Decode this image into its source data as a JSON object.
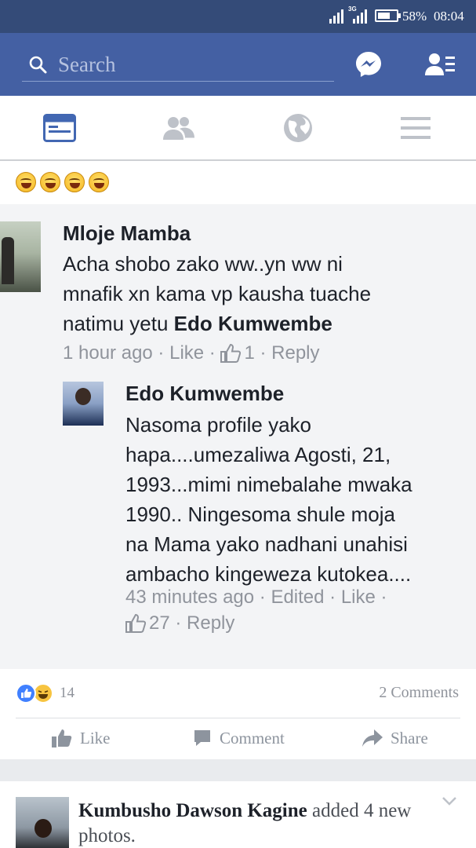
{
  "status_bar": {
    "network": "3G",
    "battery_percent": "58%",
    "battery_level": 0.58,
    "time": "08:04"
  },
  "header": {
    "search_placeholder": "Search",
    "icons": [
      "search-icon",
      "messenger-icon",
      "friend-requests-icon"
    ]
  },
  "nav_tabs": [
    {
      "name": "news-feed",
      "icon": "news-feed-icon",
      "active": true
    },
    {
      "name": "friends",
      "icon": "friends-icon",
      "active": false
    },
    {
      "name": "notifications",
      "icon": "globe-icon",
      "active": false
    },
    {
      "name": "menu",
      "icon": "hamburger-menu-icon",
      "active": false
    }
  ],
  "post": {
    "emoji_count": 4,
    "comments": [
      {
        "author": "Mloje Mamba",
        "lines": [
          "Acha shobo zako ww..yn ww ni",
          "mnafik xn kama vp kausha tuache",
          "natimu yetu "
        ],
        "mention": "Edo Kumwembe",
        "time": "1 hour ago",
        "like_label": "Like",
        "likes": "1",
        "reply_label": "Reply"
      },
      {
        "author": "Edo Kumwembe",
        "lines": [
          "Nasoma profile yako",
          "hapa....umezaliwa Agosti, 21,",
          "1993...mimi nimebalahe mwaka",
          "1990.. Ningesoma shule moja",
          "na Mama yako nadhani unahisi",
          "ambacho kingeweza kutokea...."
        ],
        "time": "43 minutes ago",
        "edited": "Edited",
        "like_label": "Like",
        "likes": "27",
        "reply_label": "Reply"
      }
    ],
    "reaction_count": "14",
    "comments_count": "2 Comments",
    "actions": {
      "like": "Like",
      "comment": "Comment",
      "share": "Share"
    }
  },
  "next_post": {
    "author": "Kumbusho Dawson Kagine",
    "text": " added 4 new photos."
  },
  "colors": {
    "header_blue": "#4460a3",
    "status_blue": "#344b78",
    "like_blue": "#4080ff"
  }
}
